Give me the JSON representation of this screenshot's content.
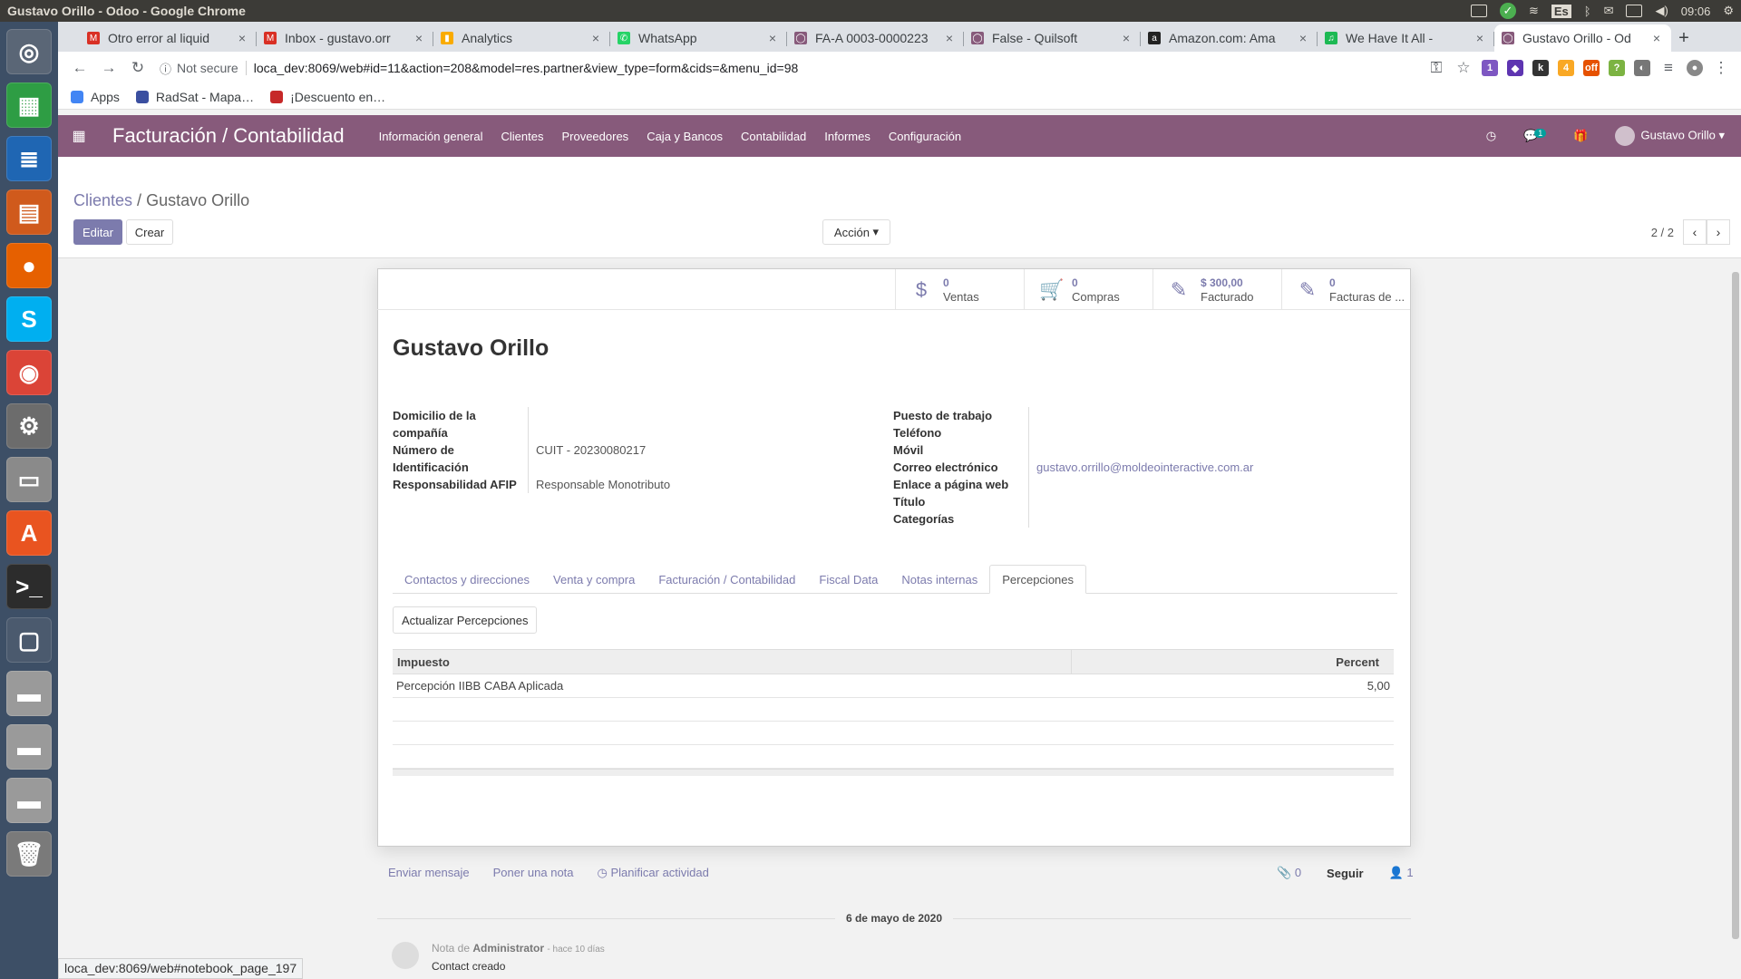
{
  "os": {
    "window_title": "Gustavo Orillo - Odoo - Google Chrome",
    "keyboard_layout": "Es",
    "clock": "09:06"
  },
  "launcher": {
    "items": [
      {
        "name": "dash-icon",
        "glyph": "◎",
        "bg": "#5a6676"
      },
      {
        "name": "calc-icon",
        "glyph": "▦",
        "bg": "#2e9d44"
      },
      {
        "name": "writer-icon",
        "glyph": "≣",
        "bg": "#1f66b3"
      },
      {
        "name": "impress-icon",
        "glyph": "▤",
        "bg": "#d05a1c"
      },
      {
        "name": "firefox-icon",
        "glyph": "●",
        "bg": "#e66000"
      },
      {
        "name": "skype-icon",
        "glyph": "S",
        "bg": "#00aff0"
      },
      {
        "name": "chrome-icon",
        "glyph": "◉",
        "bg": "#db4437"
      },
      {
        "name": "settings-icon",
        "glyph": "⚙",
        "bg": "#6c6c6c"
      },
      {
        "name": "files-icon",
        "glyph": "▭",
        "bg": "#8a8a8a"
      },
      {
        "name": "software-center-icon",
        "glyph": "A",
        "bg": "#e95420"
      },
      {
        "name": "terminal-icon",
        "glyph": ">_",
        "bg": "#2c2c2c"
      },
      {
        "name": "window-icon",
        "glyph": "▢",
        "bg": "#4b5a6e"
      },
      {
        "name": "drive-icon-1",
        "glyph": "▬",
        "bg": "#9a9a9a"
      },
      {
        "name": "drive-icon-2",
        "glyph": "▬",
        "bg": "#9a9a9a"
      },
      {
        "name": "drive-icon-3",
        "glyph": "▬",
        "bg": "#9a9a9a"
      },
      {
        "name": "trash-icon",
        "glyph": "🗑",
        "bg": "#7a7a7a"
      }
    ]
  },
  "browser": {
    "tabs": [
      {
        "label": "Otro error al liquid",
        "fav": "M",
        "color": "#d93025",
        "active": false
      },
      {
        "label": "Inbox - gustavo.orr",
        "fav": "M",
        "color": "#d93025",
        "active": false
      },
      {
        "label": "Analytics",
        "fav": "▮",
        "color": "#f9ab00",
        "active": false
      },
      {
        "label": "WhatsApp",
        "fav": "✆",
        "color": "#25d366",
        "active": false
      },
      {
        "label": "FA-A 0003-0000223",
        "fav": "◯",
        "color": "#875a7b",
        "active": false
      },
      {
        "label": "False - Quilsoft",
        "fav": "◯",
        "color": "#875a7b",
        "active": false
      },
      {
        "label": "Amazon.com: Ama",
        "fav": "a",
        "color": "#222222",
        "active": false
      },
      {
        "label": "We Have It All - ",
        "fav": "♫",
        "color": "#1db954",
        "active": false
      },
      {
        "label": "Gustavo Orillo - Od",
        "fav": "◯",
        "color": "#875a7b",
        "active": true
      }
    ],
    "security_label": "Not secure",
    "url": "loca_dev:8069/web#id=11&action=208&model=res.partner&view_type=form&cids=&menu_id=98",
    "bookmarks": [
      {
        "label": "Apps",
        "color": "#4285f4"
      },
      {
        "label": "RadSat - Mapa…",
        "color": "#3b4fa0"
      },
      {
        "label": "¡Descuento en…",
        "color": "#c62828"
      }
    ],
    "status_url": "loca_dev:8069/web#notebook_page_197"
  },
  "odoo": {
    "app_title": "Facturación / Contabilidad",
    "menu": [
      "Información general",
      "Clientes",
      "Proveedores",
      "Caja y Bancos",
      "Contabilidad",
      "Informes",
      "Configuración"
    ],
    "chat_badge": "1",
    "user_name": "Gustavo Orillo",
    "breadcrumb": {
      "parent": "Clientes",
      "separator": "/",
      "current": "Gustavo Orillo"
    },
    "buttons": {
      "edit": "Editar",
      "create": "Crear",
      "action": "Acción"
    },
    "pager": "2 / 2",
    "stats": [
      {
        "icon": "$",
        "value": "0",
        "label": "Ventas"
      },
      {
        "icon": "🛒",
        "value": "0",
        "label": "Compras"
      },
      {
        "icon": "✎",
        "value": "$ 300,00",
        "label": "Facturado"
      },
      {
        "icon": "✎",
        "value": "0",
        "label": "Facturas de ..."
      }
    ],
    "partner_name": "Gustavo Orillo",
    "left_fields": {
      "address_label": "Domicilio de la compañía",
      "vat_label": "Número de Identificación",
      "vat_value": "CUIT - 20230080217",
      "afip_label": "Responsabilidad AFIP",
      "afip_value": "Responsable Monotributo"
    },
    "right_fields": {
      "job_label": "Puesto de trabajo",
      "phone_label": "Teléfono",
      "mobile_label": "Móvil",
      "email_label": "Correo electrónico",
      "email_value": "gustavo.orrillo@moldeointeractive.com.ar",
      "website_label": "Enlace a página web",
      "title_label": "Título",
      "tags_label": "Categorías"
    },
    "tabs": [
      "Contactos y direcciones",
      "Venta y compra",
      "Facturación / Contabilidad",
      "Fiscal Data",
      "Notas internas",
      "Percepciones"
    ],
    "active_tab": "Percepciones",
    "update_button": "Actualizar Percepciones",
    "table": {
      "headers": [
        "Impuesto",
        "Percent"
      ],
      "rows": [
        [
          "Percepción IIBB CABA Aplicada",
          "5,00"
        ]
      ]
    },
    "chatter": {
      "send_message": "Enviar mensaje",
      "log_note": "Poner una nota",
      "schedule": "Planificar actividad",
      "attachments": "0",
      "follow": "Seguir",
      "followers": "1",
      "date": "6 de mayo de 2020",
      "msg_prefix": "Nota de",
      "msg_author": "Administrator",
      "msg_time": "- hace 10 días",
      "msg_body": "Contact creado"
    }
  }
}
